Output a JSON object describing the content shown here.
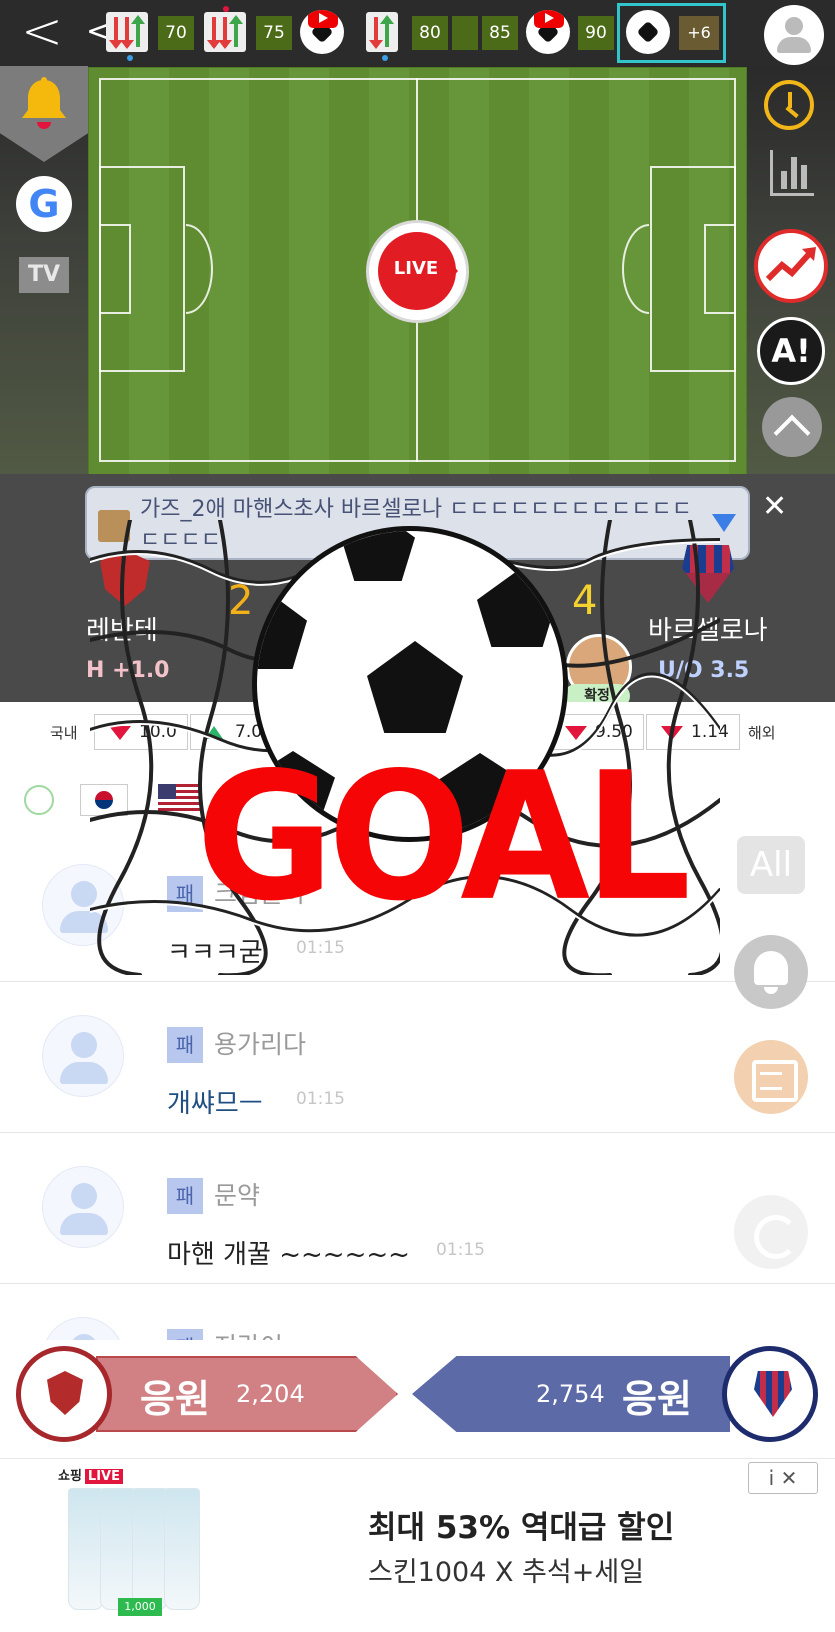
{
  "timeline": {
    "back_label": "<",
    "prev_label": "<",
    "minutes": [
      "70",
      "75",
      "80",
      "85",
      "90"
    ],
    "more_label": "+6"
  },
  "field": {
    "live_label": "LIVE"
  },
  "side_left": {
    "google_label": "G",
    "tv_label": "TV"
  },
  "side_right": {
    "ai_label": "A!"
  },
  "chat_banner": {
    "text": "가즈_2애 마핸스초사 바르셀로나 ㄷㄷㄷㄷㄷㄷㄷㄷㄷㄷㄷㄷㄷㄷㄷㄷ",
    "close_label": "✕"
  },
  "match": {
    "home_name": "레반테",
    "away_name": "바르셀로나",
    "home_score": "2",
    "away_score": "4",
    "home_handicap": "H +1.0",
    "away_ou": "U/O 3.5",
    "confirm_label": "확정"
  },
  "odds": {
    "domestic_label": "국내",
    "overseas_label": "해외",
    "values": [
      "10.0",
      "7.0",
      "9.50",
      "1.14"
    ]
  },
  "chat": [
    {
      "badge": "패",
      "user": "크림들하",
      "message": "ㅋㅋㅋ굳",
      "time": "01:15"
    },
    {
      "badge": "패",
      "user": "용가리다",
      "message": "개쌰므ㅡ",
      "time": "01:15"
    },
    {
      "badge": "패",
      "user": "문약",
      "message": "마핸 개꿀 ~~~~~~",
      "time": "01:15"
    },
    {
      "badge": "패",
      "user": "지락이",
      "message": "",
      "time": ""
    }
  ],
  "floating": {
    "all_label": "All"
  },
  "goal": {
    "label": "GOAL"
  },
  "support": {
    "home_label": "응원",
    "home_count": "2,204",
    "away_label": "응원",
    "away_count": "2,754"
  },
  "ad": {
    "brand": "쇼핑",
    "live_tag": "LIVE",
    "price_tag": "1,000",
    "title": "최대 53% 역대급 할인",
    "subtitle": "스킨1004 X 추석+세일",
    "controls": "i  ✕"
  },
  "colors": {
    "accent_red": "#e21c23",
    "pitch_green": "#5f8c31",
    "home_team": "#d18083",
    "away_team": "#5c6aa8"
  }
}
